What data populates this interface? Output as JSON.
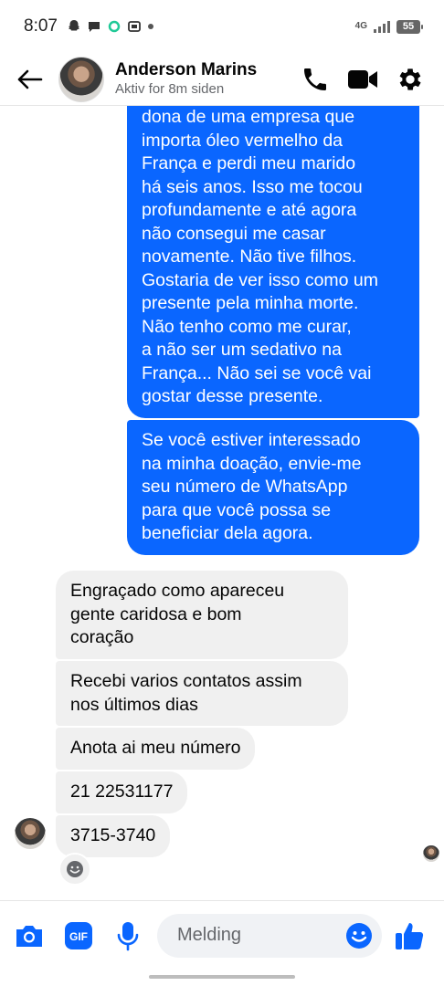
{
  "status_bar": {
    "time": "8:07",
    "network": "4G",
    "battery": "55",
    "icons": [
      "snapchat-icon",
      "chat-icon",
      "ring-icon",
      "app-icon",
      "dot-icon",
      "signal-icon"
    ]
  },
  "header": {
    "contact_name": "Anderson Marins",
    "contact_status": "Aktiv for 8m siden",
    "actions": [
      "phone-icon",
      "video-icon",
      "gear-icon"
    ]
  },
  "messages": {
    "outgoing": [
      "dona de uma empresa que\nimporta óleo vermelho da\nFrança e perdi meu marido\nhá seis anos. Isso me tocou\nprofundamente e até agora\nnão consegui me casar\nnovamente.  Não tive filhos.\nGostaria de ver isso como um\npresente pela minha morte.\nNão tenho como me curar,\na não ser um sedativo na\nFrança... Não sei se você vai\ngostar desse presente.",
      "Se você estiver interessado\nna minha doação, envie-me\nseu número de WhatsApp\npara que você possa se\nbeneficiar dela agora."
    ],
    "incoming": [
      "Engraçado como apareceu\ngente caridosa e bom\ncoração",
      "Recebi varios contatos assim\nnos últimos dias",
      "Anota ai meu número",
      "21 22531177",
      "3715-3740"
    ]
  },
  "composer": {
    "placeholder": "Melding",
    "icons": [
      "camera-icon",
      "gif-icon",
      "microphone-icon",
      "emoji-icon",
      "like-icon"
    ],
    "gif_label": "GIF"
  },
  "colors": {
    "accent": "#0a66ff",
    "incoming_bubble": "#f0f0f0",
    "secondary_text": "#65676b"
  }
}
